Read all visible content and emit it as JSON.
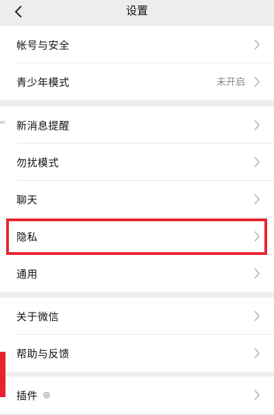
{
  "header": {
    "title": "设置",
    "back_icon": "chevron-left-icon"
  },
  "groups": [
    {
      "rows": [
        {
          "label": "帐号与安全",
          "value": ""
        },
        {
          "label": "青少年模式",
          "value": "未开启"
        }
      ]
    },
    {
      "rows": [
        {
          "label": "新消息提醒",
          "value": ""
        },
        {
          "label": "勿扰模式",
          "value": ""
        },
        {
          "label": "聊天",
          "value": ""
        },
        {
          "label": "隐私",
          "value": ""
        },
        {
          "label": "通用",
          "value": ""
        }
      ]
    },
    {
      "rows": [
        {
          "label": "关于微信",
          "value": ""
        },
        {
          "label": "帮助与反馈",
          "value": ""
        }
      ]
    },
    {
      "rows": [
        {
          "label": "插件",
          "value": "",
          "icon": "gear-icon"
        }
      ]
    }
  ],
  "colors": {
    "highlight": "#e8232f",
    "background": "#ededed",
    "row_background": "#ffffff"
  }
}
